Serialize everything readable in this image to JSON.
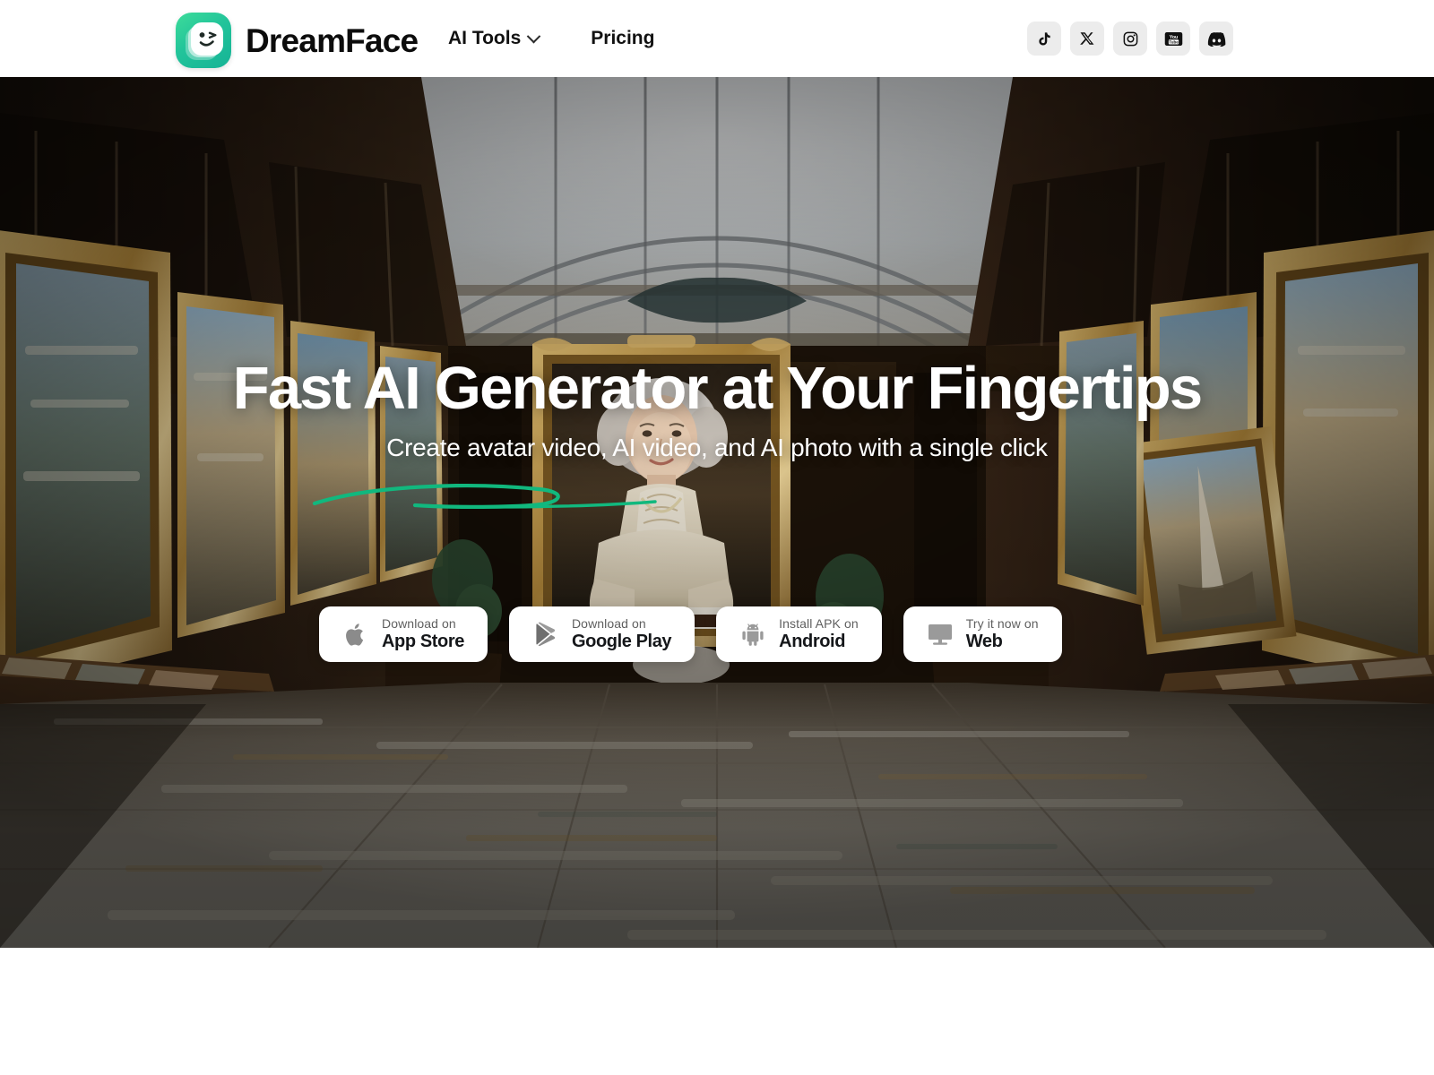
{
  "header": {
    "brand": {
      "name": "DreamFace",
      "logo_icon": "dreamface-winking-face-logo",
      "logo_color": "#22c49a"
    },
    "nav": [
      {
        "label": "AI Tools",
        "has_dropdown": true,
        "dropdown_icon": "chevron-down-icon"
      },
      {
        "label": "Pricing",
        "has_dropdown": false
      }
    ],
    "socials": [
      {
        "name": "tiktok",
        "icon": "tiktok-icon"
      },
      {
        "name": "x",
        "icon": "x-twitter-icon"
      },
      {
        "name": "instagram",
        "icon": "instagram-icon"
      },
      {
        "name": "youtube",
        "icon": "youtube-icon"
      },
      {
        "name": "discord",
        "icon": "discord-icon"
      }
    ]
  },
  "hero": {
    "headline": "Fast AI Generator at Your Fingertips",
    "subhead": "Create avatar video, AI video, and AI photo with a single click",
    "accent_color": "#11b87e",
    "background_description": "Ornate art gallery hall with gilded framed paintings, arched glass skylight ceiling and polished reflective stone floor, centered portrait of an elegant silver-haired woman in Victorian dress",
    "download_buttons": [
      {
        "top": "Download on",
        "bottom": "App Store",
        "icon": "apple-icon"
      },
      {
        "top": "Download on",
        "bottom": "Google Play",
        "icon": "google-play-icon"
      },
      {
        "top": "Install APK on",
        "bottom": "Android",
        "icon": "android-icon"
      },
      {
        "top": "Try it now on",
        "bottom": "Web",
        "icon": "monitor-icon"
      }
    ]
  }
}
